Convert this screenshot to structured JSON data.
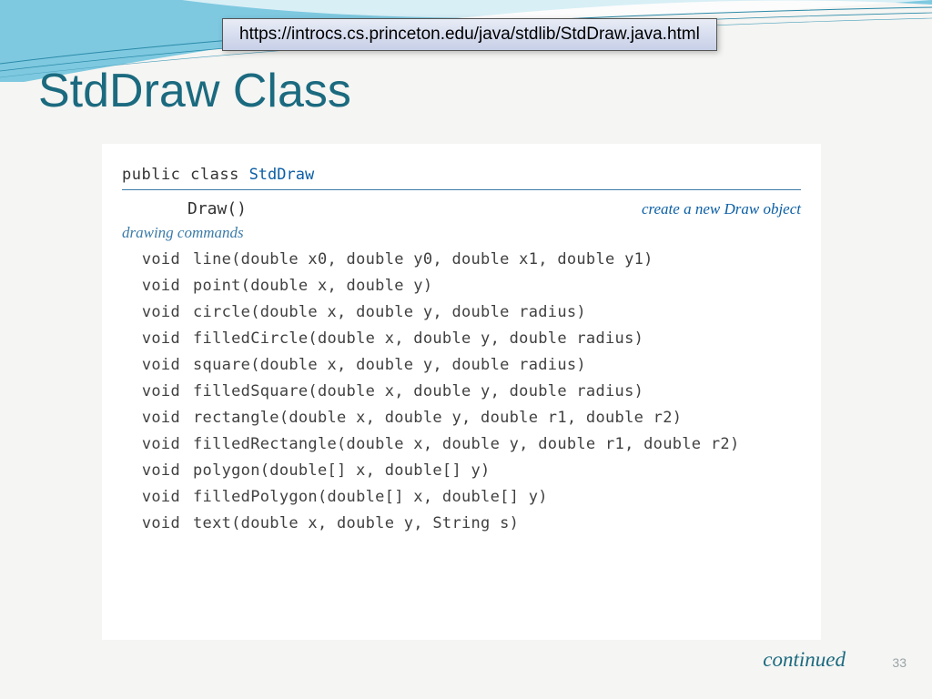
{
  "url": "https://introcs.cs.princeton.edu/java/stdlib/StdDraw.java.html",
  "title": "StdDraw Class",
  "class_keywords": "public class ",
  "class_name": "StdDraw",
  "constructor": {
    "signature": "Draw()",
    "desc_prefix": "create a new ",
    "desc_obj": "Draw",
    "desc_suffix": " object"
  },
  "section_label": "drawing commands",
  "methods": [
    {
      "ret": "void",
      "sig": "line(double x0, double y0, double x1, double y1)"
    },
    {
      "ret": "void",
      "sig": "point(double x, double y)"
    },
    {
      "ret": "void",
      "sig": "circle(double x, double y, double radius)"
    },
    {
      "ret": "void",
      "sig": "filledCircle(double x, double y, double radius)"
    },
    {
      "ret": "void",
      "sig": "square(double x, double y, double radius)"
    },
    {
      "ret": "void",
      "sig": "filledSquare(double x, double y, double radius)"
    },
    {
      "ret": "void",
      "sig": "rectangle(double x, double y, double r1, double r2)"
    },
    {
      "ret": "void",
      "sig": "filledRectangle(double x, double y, double r1, double r2)"
    },
    {
      "ret": "void",
      "sig": "polygon(double[] x, double[] y)"
    },
    {
      "ret": "void",
      "sig": "filledPolygon(double[] x, double[] y)"
    },
    {
      "ret": "void",
      "sig": "text(double x, double y, String s)"
    }
  ],
  "continued": "continued",
  "slide_number": "33"
}
